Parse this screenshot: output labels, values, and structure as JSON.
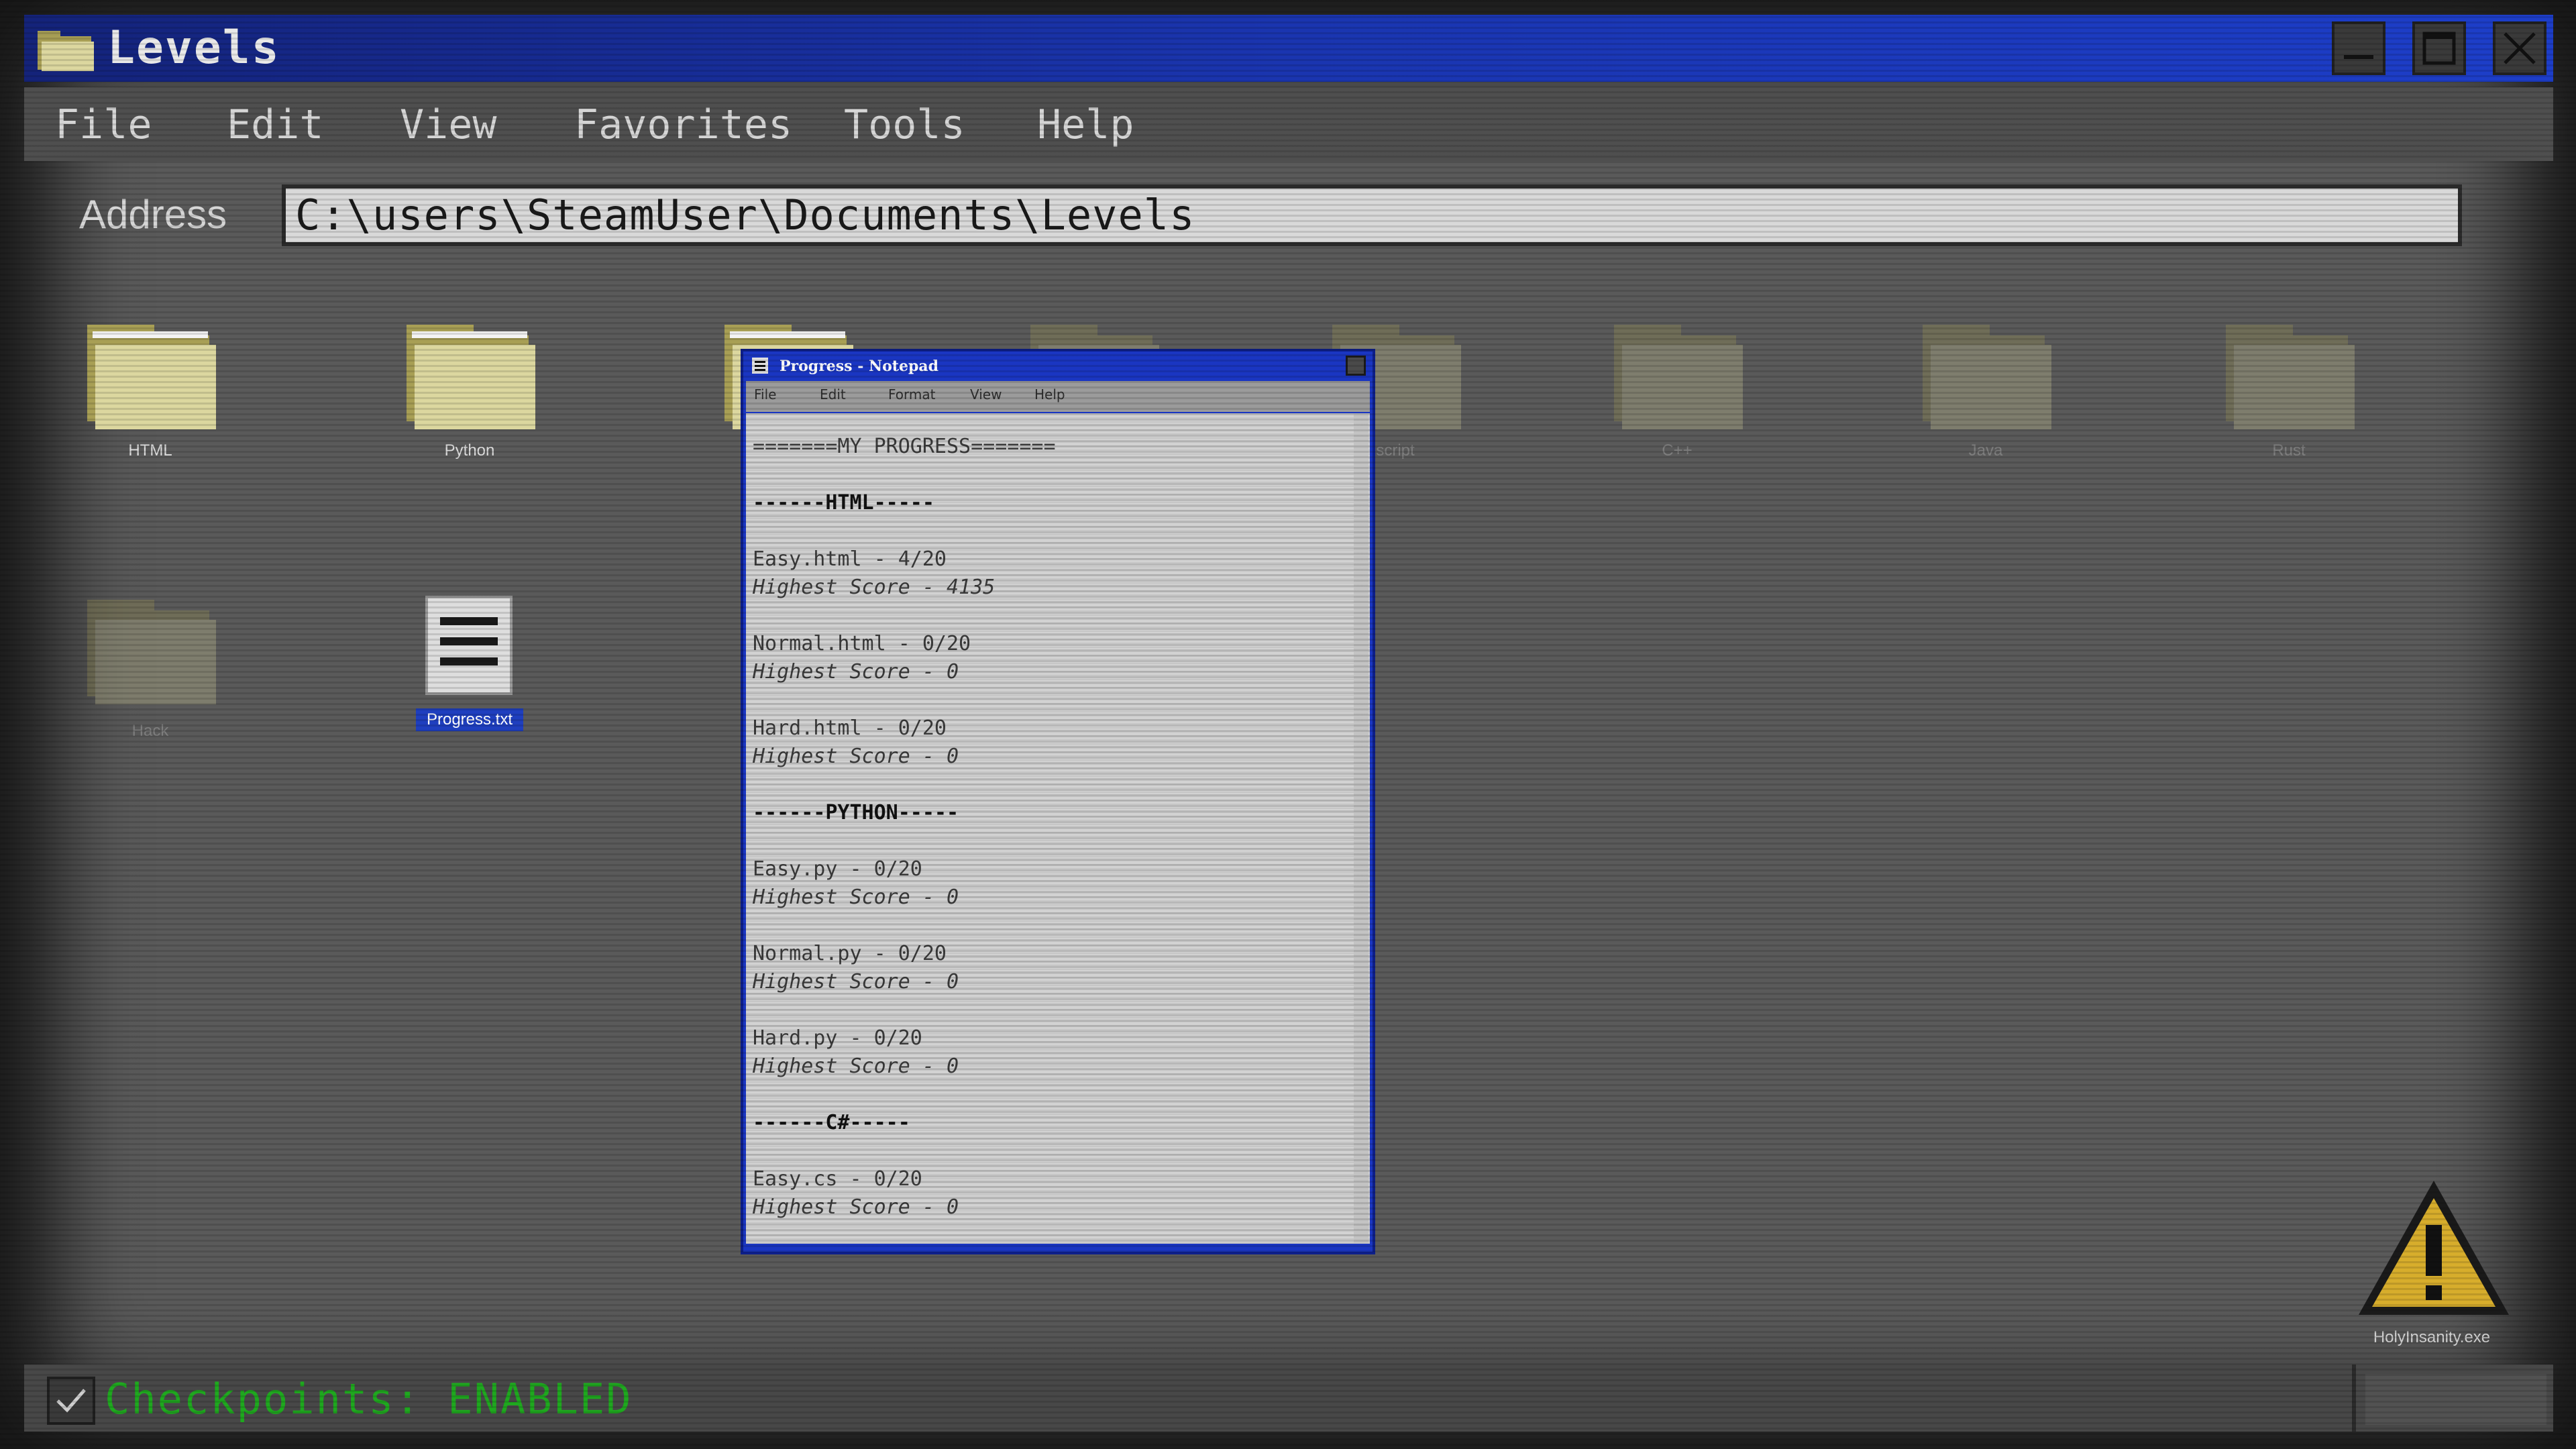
{
  "window": {
    "title": "Levels",
    "icon": "folder-icon"
  },
  "menu": [
    "File",
    "Edit",
    "View",
    "Favorites",
    "Tools",
    "Help"
  ],
  "address": {
    "label": "Address",
    "path": "C:\\users\\SteamUser\\Documents\\Levels"
  },
  "desktop": {
    "folders": [
      {
        "label": "HTML"
      },
      {
        "label": "Python"
      },
      {
        "label": ""
      },
      {
        "label": ""
      },
      {
        "label": "script"
      },
      {
        "label": "C++"
      },
      {
        "label": "Java"
      },
      {
        "label": "Rust"
      },
      {
        "label": "Hack"
      }
    ],
    "file": {
      "label": "Progress.txt",
      "icon": "text-file-icon"
    },
    "exe": {
      "label": "HolyInsanity.exe",
      "icon": "warning-icon"
    }
  },
  "notepad": {
    "title": "Progress - Notepad",
    "menu": [
      "File",
      "Edit",
      "Format",
      "View",
      "Help"
    ],
    "lines": [
      "=======MY PROGRESS=======",
      "------HTML-----",
      "Easy.html - 4/20",
      "Highest Score - 4135",
      "Normal.html - 0/20",
      "Highest Score - 0",
      "Hard.html - 0/20",
      "Highest Score - 0",
      "------PYTHON-----",
      "Easy.py - 0/20",
      "Highest Score - 0",
      "Normal.py - 0/20",
      "Highest Score - 0",
      "Hard.py - 0/20",
      "Highest Score - 0",
      "------C#-----",
      "Easy.cs - 0/20",
      "Highest Score - 0"
    ]
  },
  "status": {
    "text": "Checkpoints: ENABLED",
    "color": "#1fa81f"
  },
  "colors": {
    "titlebar": "#1a35b0",
    "folder": "#d8d79a",
    "selection": "#1f3fbf"
  }
}
